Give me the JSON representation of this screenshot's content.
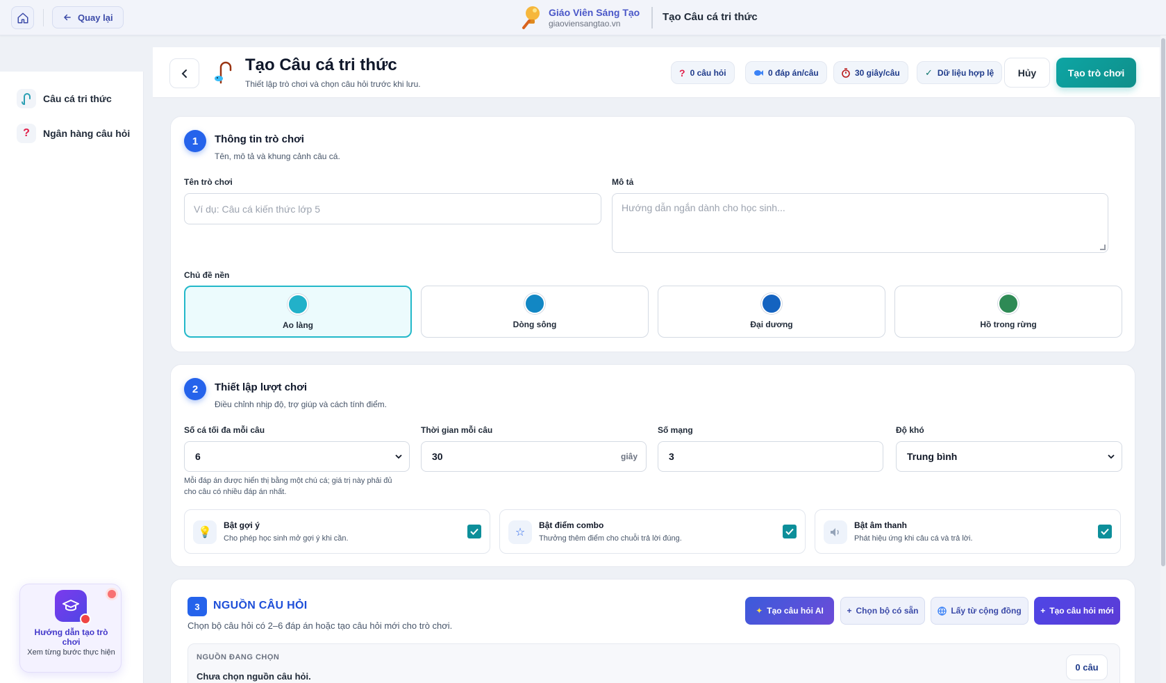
{
  "topbar": {
    "back_label": "Quay lại",
    "brand_name": "Giáo Viên Sáng Tạo",
    "brand_url": "giaoviensangtao.vn",
    "page_name": "Tạo Câu cá tri thức"
  },
  "sidebar": {
    "items": [
      {
        "label": "Câu cá tri thức",
        "icon": "fishing-hook-icon"
      },
      {
        "label": "Ngân hàng câu hỏi",
        "icon": "question-mark-icon"
      }
    ],
    "guide": {
      "title": "Hướng dẫn tạo trò chơi",
      "subtitle": "Xem từng bước thực hiện"
    }
  },
  "header": {
    "title": "Tạo Câu cá tri thức",
    "subtitle": "Thiết lập trò chơi và chọn câu hỏi trước khi lưu.",
    "chips": [
      {
        "icon": "question-mark-icon",
        "label": "0 câu hỏi"
      },
      {
        "icon": "fish-icon",
        "label": "0 đáp án/câu"
      },
      {
        "icon": "stopwatch-icon",
        "label": "30 giây/câu"
      },
      {
        "icon": "check-icon",
        "label": "Dữ liệu hợp lệ"
      }
    ],
    "cancel_label": "Hủy",
    "create_label": "Tạo trò chơi"
  },
  "section1": {
    "step": "1",
    "title": "Thông tin trò chơi",
    "subtitle": "Tên, mô tả và khung cảnh câu cá.",
    "name_label": "Tên trò chơi",
    "name_placeholder": "Ví dụ: Câu cá kiến thức lớp 5",
    "desc_label": "Mô tả",
    "desc_placeholder": "Hướng dẫn ngắn dành cho học sinh...",
    "theme_label": "Chủ đề nền",
    "themes": [
      {
        "label": "Ao làng",
        "color": "#22b1c9",
        "selected": true
      },
      {
        "label": "Dòng sông",
        "color": "#1287c4",
        "selected": false
      },
      {
        "label": "Đại dương",
        "color": "#1463c0",
        "selected": false
      },
      {
        "label": "Hồ trong rừng",
        "color": "#2e8a55",
        "selected": false
      }
    ]
  },
  "section2": {
    "step": "2",
    "title": "Thiết lập lượt chơi",
    "subtitle": "Điều chỉnh nhịp độ, trợ giúp và cách tính điểm.",
    "max_fish_label": "Số cá tối đa mỗi câu",
    "max_fish_value": "6",
    "max_fish_hint": "Mỗi đáp án được hiển thị bằng một chú cá; giá trị này phải đủ cho câu có nhiều đáp án nhất.",
    "time_label": "Thời gian mỗi câu",
    "time_value": "30",
    "time_unit": "giây",
    "lives_label": "Số mạng",
    "lives_value": "3",
    "difficulty_label": "Độ khó",
    "difficulty_value": "Trung bình",
    "toggles": [
      {
        "icon": "lightbulb-icon",
        "title": "Bật gợi ý",
        "subtitle": "Cho phép học sinh mở gợi ý khi cần.",
        "checked": true
      },
      {
        "icon": "star-icon",
        "title": "Bật điểm combo",
        "subtitle": "Thưởng thêm điểm cho chuỗi trả lời đúng.",
        "checked": true
      },
      {
        "icon": "speaker-icon",
        "title": "Bật âm thanh",
        "subtitle": "Phát hiệu ứng khi câu cá và trả lời.",
        "checked": true
      }
    ]
  },
  "section3": {
    "step": "3",
    "title": "NGUỒN CÂU HỎI",
    "subtitle": "Chọn bộ câu hỏi có 2–6 đáp án hoặc tạo câu hỏi mới cho trò chơi.",
    "actions": {
      "ai": "Tạo câu hỏi AI",
      "library": "Chọn bộ có sẵn",
      "community": "Lấy từ cộng đồng",
      "new": "Tạo câu hỏi mới"
    },
    "source_label": "NGUỒN ĐANG CHỌN",
    "source_value": "Chưa chọn nguồn câu hỏi.",
    "source_count": "0 câu"
  }
}
